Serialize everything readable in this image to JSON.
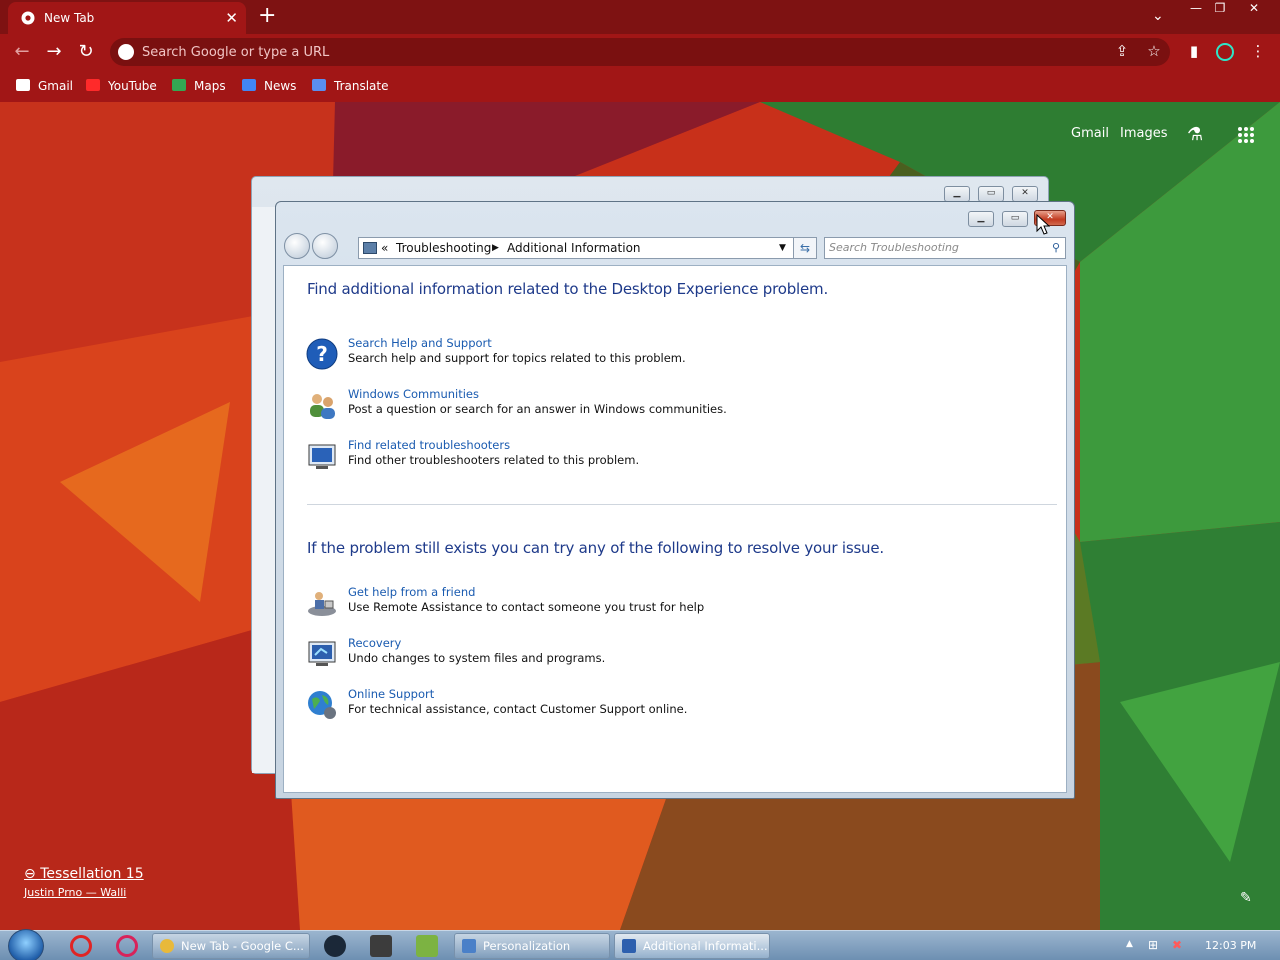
{
  "browser": {
    "tab_title": "New Tab",
    "tab_close": "✕",
    "new_tab": "+",
    "omnibox_placeholder": "Search Google or type a URL",
    "bookmarks": [
      "Gmail",
      "YouTube",
      "Maps",
      "News",
      "Translate"
    ]
  },
  "ntp": {
    "gmail": "Gmail",
    "images": "Images",
    "attribution_title": "Tessellation 15",
    "attribution_author": "Justin Prno — Walli"
  },
  "window": {
    "breadcrumb_root": "Troubleshooting",
    "breadcrumb_current": "Additional Information",
    "search_placeholder": "Search Troubleshooting",
    "heading1": "Find additional information related to the Desktop Experience problem.",
    "heading2": "If the problem still exists you can try any of the following to resolve your issue.",
    "items_top": [
      {
        "link": "Search Help and Support",
        "desc": "Search help and support for topics related to this problem.",
        "icon": "help-icon"
      },
      {
        "link": "Windows Communities",
        "desc": "Post a question or search for an answer in Windows communities.",
        "icon": "users-icon"
      },
      {
        "link": "Find related troubleshooters",
        "desc": "Find other troubleshooters related to this problem.",
        "icon": "troubleshooter-icon"
      }
    ],
    "items_bottom": [
      {
        "link": "Get help from a friend",
        "desc": "Use Remote Assistance to contact someone you trust for help",
        "icon": "remote-assistance-icon"
      },
      {
        "link": "Recovery",
        "desc": "Undo changes to system files and programs.",
        "icon": "recovery-icon"
      },
      {
        "link": "Online Support",
        "desc": "For technical assistance, contact Customer Support online.",
        "icon": "globe-icon"
      }
    ]
  },
  "taskbar": {
    "tasks": [
      "New Tab - Google C...",
      "Personalization",
      "Additional Informati..."
    ],
    "clock": "12:03 PM"
  }
}
